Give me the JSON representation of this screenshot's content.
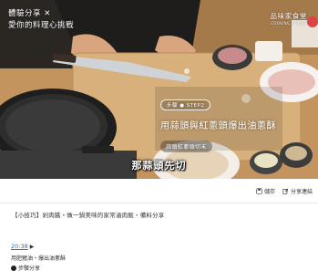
{
  "video": {
    "watermark_left": [
      "體驗分享 ✕",
      "愛你的料理心挑戰"
    ],
    "watermark_right": "品味家食堂",
    "watermark_right_sub": "COOKING STUDIO",
    "step_tag": "步驟 ● STEP2",
    "step_title": "用蒜頭與紅蔥頭爆出油蔥酥",
    "step_sub": "蒜頭紅蔥頭切末",
    "subtitle": "那蒜頭先切"
  },
  "actions": [
    {
      "icon": "save-icon",
      "label": "儲存"
    },
    {
      "icon": "share-icon",
      "label": "分享連結"
    }
  ],
  "description": "【小技巧】剁肉醬・做一鍋美味的家常滷肉飯・備料分享",
  "chapter": {
    "time": "20:38",
    "play_symbol": "▶"
  },
  "chapter_sub": "用肥豬油・爆出油蔥酥",
  "context_label": "步驟分享"
}
